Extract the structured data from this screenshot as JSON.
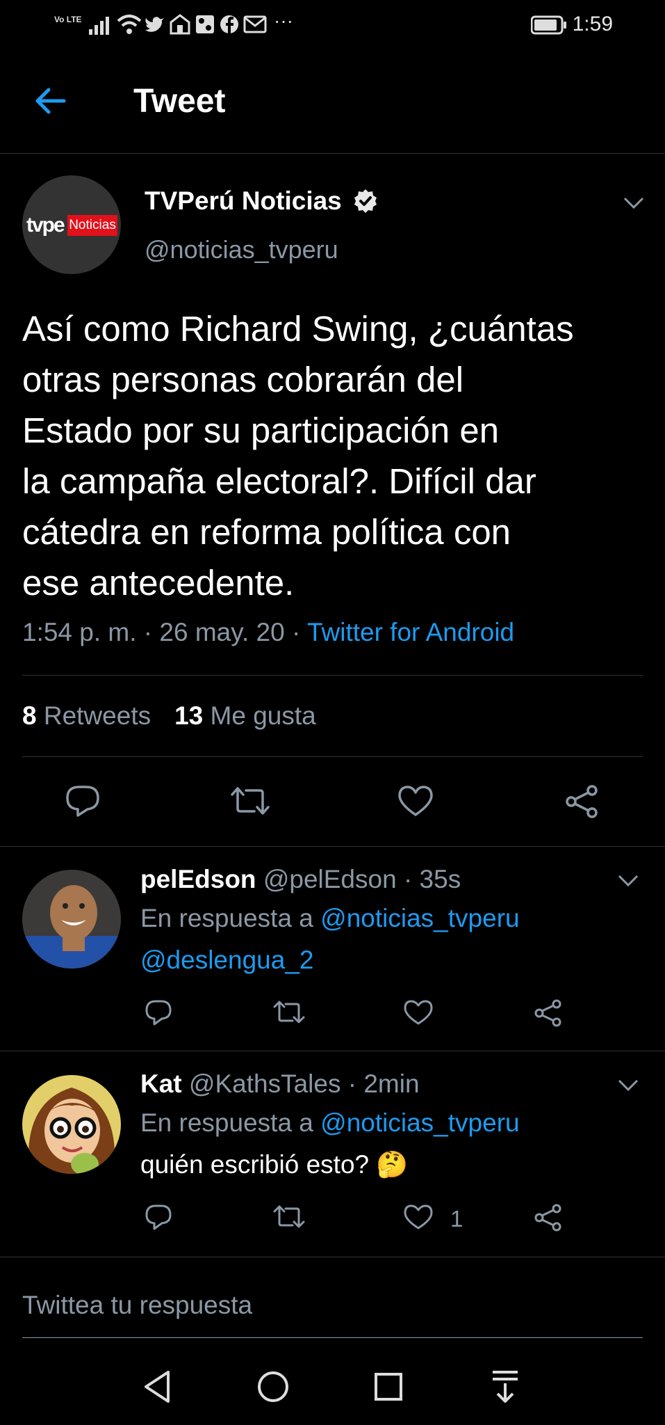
{
  "status_bar": {
    "network": "Vo LTE",
    "time": "1:59",
    "icons": [
      "signal-icon",
      "wifi-icon",
      "twitter-icon",
      "app-icon",
      "app-icon",
      "facebook-icon",
      "mail-icon",
      "more-icon",
      "battery-icon"
    ]
  },
  "header": {
    "title": "Tweet"
  },
  "tweet": {
    "author_name": "TVPerú Noticias",
    "author_handle": "@noticias_tvperu",
    "avatar_logo_text": "tvpe",
    "avatar_logo_badge": "Noticias",
    "text_lines": [
      "Así como Richard Swing, ¿cuántas",
      "otras personas cobrarán del",
      "Estado por su participación en",
      "la campaña electoral?. Difícil dar",
      "cátedra en reforma política con",
      "ese antecedente."
    ],
    "timestamp": "1:54 p. m. · 26 may. 20 · ",
    "source": "Twitter for Android",
    "retweets_count": "8",
    "retweets_label": "Retweets",
    "likes_count": "13",
    "likes_label": "Me gusta"
  },
  "replies": [
    {
      "name": "pelEdson",
      "handle_time": "@pelEdson · 35s",
      "reply_prefix": "En respuesta a ",
      "reply_to": "@noticias_tvperu",
      "body": "@deslengua_2",
      "likes": ""
    },
    {
      "name": "Kat",
      "handle_time": "@KathsTales · 2min",
      "reply_prefix": "En respuesta a ",
      "reply_to": "@noticias_tvperu",
      "body": "quién escribió esto? 🤔",
      "likes": "1"
    }
  ],
  "compose": {
    "placeholder": "Twittea tu respuesta"
  },
  "colors": {
    "accent": "#1d9bf0",
    "muted": "#8b98a5",
    "divider": "#2f3336",
    "background": "#000000"
  }
}
